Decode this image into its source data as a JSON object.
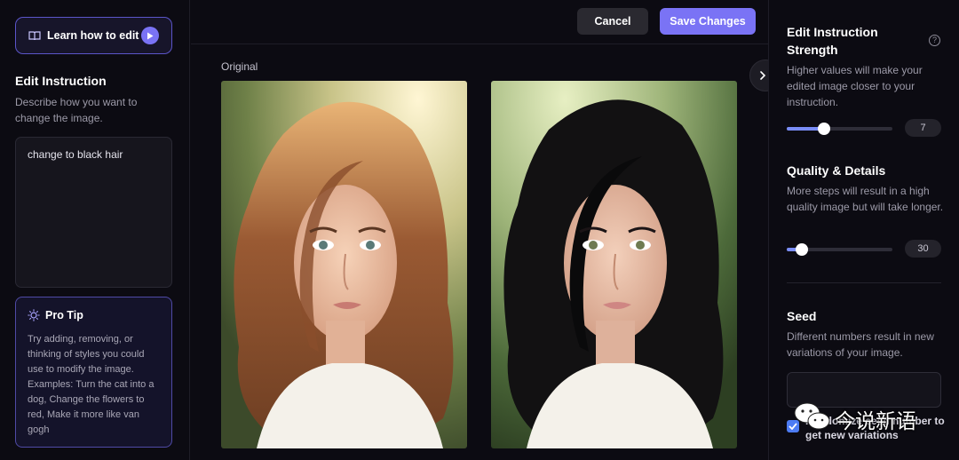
{
  "left": {
    "learn_button": "Learn how to edit",
    "title": "Edit Instruction",
    "description": "Describe how you want to change the image.",
    "instruction_value": "change to black hair",
    "pro_tip": {
      "title": "Pro Tip",
      "body": "Try adding, removing, or thinking of styles you could use to modify the image. Examples: Turn the cat into a dog, Change the flowers to red, Make it more like van gogh"
    }
  },
  "toolbar": {
    "cancel_label": "Cancel",
    "save_label": "Save Changes"
  },
  "center": {
    "original_label": "Original"
  },
  "right": {
    "strength": {
      "title": "Edit Instruction Strength",
      "description": "Higher values will make your edited image closer to your instruction.",
      "value": "7",
      "fraction": 0.35
    },
    "quality": {
      "title": "Quality & Details",
      "description": "More steps will result in a high quality image but will take longer.",
      "value": "30",
      "fraction": 0.14
    },
    "seed": {
      "title": "Seed",
      "description": "Different numbers result in new variations of your image.",
      "value": "",
      "randomize_label": "Randomize seed number to get new variations",
      "randomize_checked": true
    }
  },
  "watermark": {
    "text": "今说新语"
  },
  "colors": {
    "accent": "#7a73f5",
    "slider_fill": "#7a8df7",
    "checkbox": "#4d7cf4"
  }
}
